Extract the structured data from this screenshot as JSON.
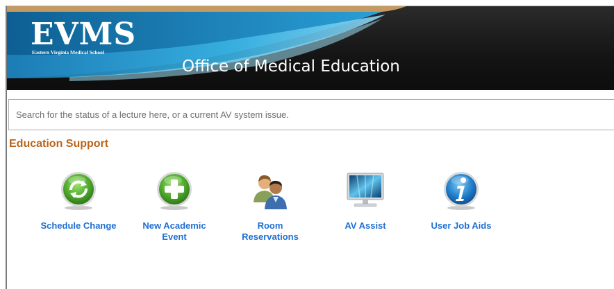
{
  "header": {
    "logo_text": "EVMS",
    "logo_subtitle": "Eastern Virginia Medical School",
    "title": "Office of Medical Education"
  },
  "search": {
    "placeholder": "Search for the status of a lecture here, or a current AV system issue."
  },
  "section": {
    "title": "Education Support"
  },
  "tiles": [
    {
      "label": "Schedule Change",
      "icon": "refresh-icon"
    },
    {
      "label": "New Academic\nEvent",
      "icon": "plus-icon"
    },
    {
      "label": "Room\nReservations",
      "icon": "people-icon"
    },
    {
      "label": "AV Assist",
      "icon": "monitor-icon"
    },
    {
      "label": "User Job Aids",
      "icon": "info-icon"
    }
  ],
  "colors": {
    "banner_bg": "#141414",
    "wave_blue": "#2fa6d8",
    "wave_tan": "#c49a62",
    "section_title": "#b8641a",
    "tile_label": "#1f6fd2"
  }
}
